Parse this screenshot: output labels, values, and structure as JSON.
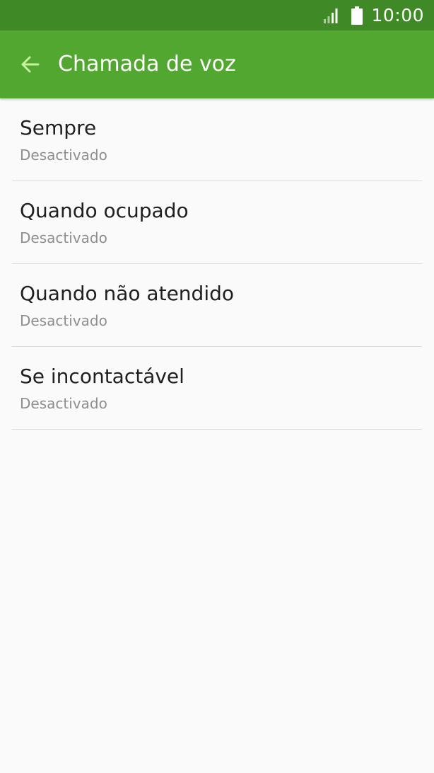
{
  "status_bar": {
    "time": "10:00",
    "icons": [
      "signal-icon",
      "battery-icon"
    ]
  },
  "app_bar": {
    "title": "Chamada de voz",
    "back_icon": "arrow-back-icon"
  },
  "colors": {
    "status_bar": "#3f8a26",
    "app_bar": "#52a730",
    "back_arrow": "#c8f29a",
    "background": "#fafafa"
  },
  "list": {
    "items": [
      {
        "title": "Sempre",
        "subtitle": "Desactivado"
      },
      {
        "title": "Quando ocupado",
        "subtitle": "Desactivado"
      },
      {
        "title": "Quando não atendido",
        "subtitle": "Desactivado"
      },
      {
        "title": "Se incontactável",
        "subtitle": "Desactivado"
      }
    ]
  }
}
